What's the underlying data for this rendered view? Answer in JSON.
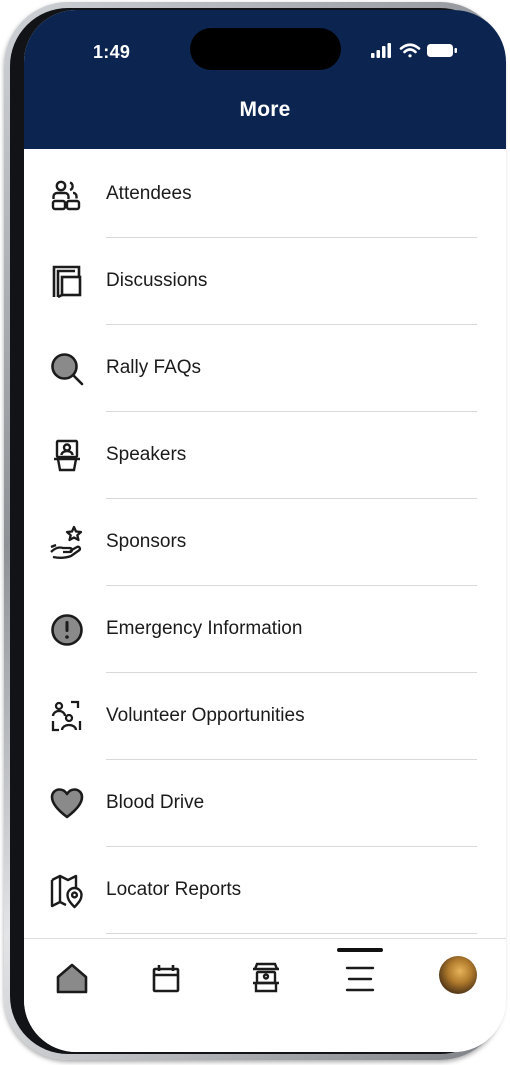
{
  "status_bar": {
    "time": "1:49"
  },
  "header": {
    "title": "More"
  },
  "menu": {
    "items": [
      {
        "label": "Attendees",
        "icon": "attendees-icon"
      },
      {
        "label": "Discussions",
        "icon": "discussions-icon"
      },
      {
        "label": "Rally FAQs",
        "icon": "search-icon"
      },
      {
        "label": "Speakers",
        "icon": "speaker-podium-icon"
      },
      {
        "label": "Sponsors",
        "icon": "sponsor-hand-star-icon"
      },
      {
        "label": "Emergency Information",
        "icon": "alert-circle-icon"
      },
      {
        "label": "Volunteer Opportunities",
        "icon": "volunteer-icon"
      },
      {
        "label": "Blood Drive",
        "icon": "heart-icon"
      },
      {
        "label": "Locator Reports",
        "icon": "map-pin-icon"
      }
    ]
  },
  "tab_bar": {
    "tabs": [
      {
        "icon": "home-icon"
      },
      {
        "icon": "calendar-icon"
      },
      {
        "icon": "booth-icon"
      },
      {
        "icon": "menu-icon",
        "selected": true
      },
      {
        "icon": "profile-avatar"
      }
    ]
  },
  "colors": {
    "header_bg": "#0c2550",
    "header_text": "#ffffff",
    "text": "#1b1b1b",
    "divider": "#d9d9d9"
  }
}
